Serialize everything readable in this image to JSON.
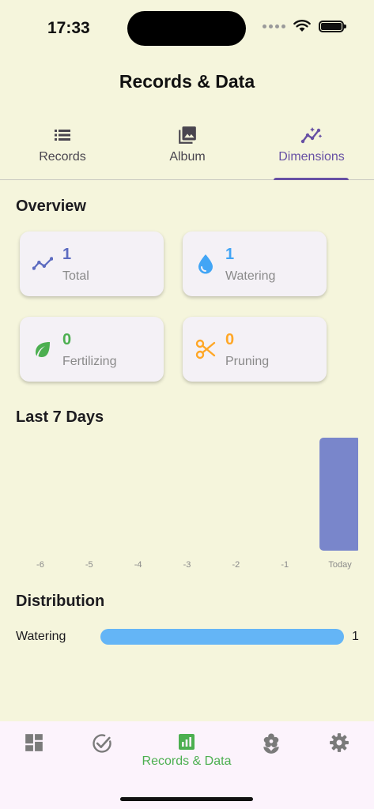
{
  "status_bar": {
    "time": "17:33"
  },
  "header": {
    "title": "Records & Data"
  },
  "tabs": [
    {
      "label": "Records",
      "icon": "list-icon"
    },
    {
      "label": "Album",
      "icon": "photo-library-icon"
    },
    {
      "label": "Dimensions",
      "icon": "insights-icon",
      "active": true
    }
  ],
  "overview": {
    "title": "Overview",
    "cards": [
      {
        "value": "1",
        "label": "Total",
        "icon": "trend-line-icon",
        "color": "#5C6BC0"
      },
      {
        "value": "1",
        "label": "Watering",
        "icon": "water-drop-icon",
        "color": "#42A5F5"
      },
      {
        "value": "0",
        "label": "Fertilizing",
        "icon": "leaf-icon",
        "color": "#4CAF50"
      },
      {
        "value": "0",
        "label": "Pruning",
        "icon": "scissors-icon",
        "color": "#FFA726"
      }
    ]
  },
  "last7": {
    "title": "Last 7 Days",
    "chart_data": {
      "type": "bar",
      "categories": [
        "-6",
        "-5",
        "-4",
        "-3",
        "-2",
        "-1",
        "Today"
      ],
      "values": [
        0,
        0,
        0,
        0,
        0,
        0,
        1
      ],
      "title": "Last 7 Days",
      "xlabel": "",
      "ylabel": "",
      "ylim": [
        0,
        1
      ],
      "grid": false,
      "bar_color": "#7986CB"
    }
  },
  "distribution": {
    "title": "Distribution",
    "items": [
      {
        "label": "Watering",
        "count": "1",
        "fraction": 1.0,
        "color": "#64B5F6"
      }
    ]
  },
  "bottom_nav": [
    {
      "label": "",
      "icon": "dashboard-icon"
    },
    {
      "label": "",
      "icon": "check-circle-icon"
    },
    {
      "label": "Records & Data",
      "icon": "bar-chart-icon",
      "active": true
    },
    {
      "label": "",
      "icon": "flower-icon"
    },
    {
      "label": "",
      "icon": "settings-icon"
    }
  ],
  "colors": {
    "background": "#F5F5DC",
    "accent_purple": "#6750A4",
    "accent_green": "#4CAF50"
  }
}
